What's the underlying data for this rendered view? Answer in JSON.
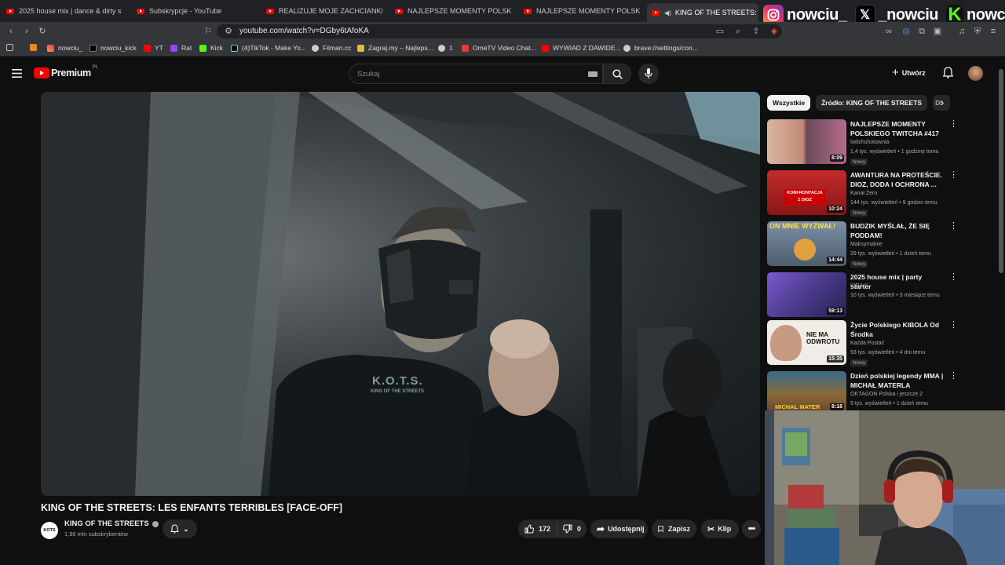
{
  "browser": {
    "tabs": [
      {
        "label": "2025 house mix | dance & dirty s"
      },
      {
        "label": "Subskrypcje - YouTube"
      },
      {
        "label": "REALIZUJE MOJE ZACHCIANKI CIĄŻO"
      },
      {
        "label": "NAJLEPSZE MOMENTY POLSKIEGO T"
      },
      {
        "label": "NAJLEPSZE MOMENTY POLSKIEGO T"
      },
      {
        "label": "KING OF THE STREETS: LES EN"
      }
    ],
    "url": "youtube.com/watch?v=DGby6tAfoKA",
    "bookmarks": [
      {
        "label": ""
      },
      {
        "label": "nowciu_"
      },
      {
        "label": "nowciu_kick"
      },
      {
        "label": "YT"
      },
      {
        "label": "Rat"
      },
      {
        "label": "Kick"
      },
      {
        "label": "(4)TikTok - Make Yo..."
      },
      {
        "label": "Filman.cc"
      },
      {
        "label": "Zagraj.my – Najleps..."
      },
      {
        "label": "1"
      },
      {
        "label": "OmeTV Video Chat..."
      },
      {
        "label": "WYWIAD Z DAWIDE..."
      },
      {
        "label": "brave://settings/con..."
      }
    ]
  },
  "overlay": {
    "instagram": "nowciu_",
    "x": "_nowciu",
    "kick": "nowciu"
  },
  "youtube": {
    "logo": "Premium",
    "logo_region": "PL",
    "search_placeholder": "Szukaj",
    "create_label": "Utwórz"
  },
  "video": {
    "title": "KING OF THE STREETS: LES ENFANTS TERRIBLES [FACE-OFF]",
    "channel": "KING OF THE STREETS",
    "subscribers": "1,96 mln subskrybentów",
    "likes": "172",
    "dislikes": "0",
    "share_label": "Udostępnij",
    "save_label": "Zapisz",
    "clip_label": "Klip",
    "shirt_text": "K.O.T.S.",
    "shirt_sub": "KING OF THE STREETS"
  },
  "sidebar": {
    "chips": [
      "Wszystkie",
      "Źródło: KING OF THE STREETS",
      "Dl"
    ],
    "recommendations": [
      {
        "title": "NAJLEPSZE MOMENTY POLSKIEGO TWITCHA #417",
        "channel": "twitchshotownia",
        "meta": "1,4 tys. wyświetleń • 1 godzinę temu",
        "badge": "Nowy",
        "duration": "8:09",
        "thumb": "#c48a7a"
      },
      {
        "title": "AWANTURA NA PROTEŚCIE. DIOZ, DODA I OCHRONA ...",
        "channel": "Kanał Zero",
        "meta": "144 tys. wyświetleń • 9 godzin temu",
        "badge": "Nowy",
        "duration": "10:24",
        "thumb": "#b02a2a",
        "thumb_text": "KONFRONTACJA Z DIOZ"
      },
      {
        "title": "BUDZIK MYŚLAŁ, ŻE SIĘ PODDAM!",
        "channel": "Maksymalnie",
        "meta": "29 tys. wyświetleń • 1 dzień temu",
        "badge": "Nowy",
        "duration": "14:44",
        "thumb": "#6a7d92",
        "thumb_text": "ON MNIE WYZWAŁ!"
      },
      {
        "title": "2025 house mix | party starter",
        "channel": "KIRA X",
        "meta": "10 tys. wyświetleń • 3 miesiące temu",
        "badge": "",
        "duration": "59:13",
        "thumb": "#4a3a8a"
      },
      {
        "title": "Życie Polskiego KIBOLA Od Środka",
        "channel": "Każda Postać",
        "meta": "93 tys. wyświetleń • 4 dni temu",
        "badge": "Nowy",
        "duration": "15:35",
        "thumb": "#e8e4dc",
        "thumb_text": "NIE MA ODWROTU"
      },
      {
        "title": "Dzień polskiej legendy MMA | MICHAŁ MATERLA",
        "channel": "OKTAGON Polska i jeszcze 2",
        "meta": "9 tys. wyświetleń • 1 dzień temu",
        "badge": "",
        "duration": "8:18",
        "thumb": "#8a6a3a",
        "thumb_text": "MICHAŁ MATER"
      }
    ]
  }
}
